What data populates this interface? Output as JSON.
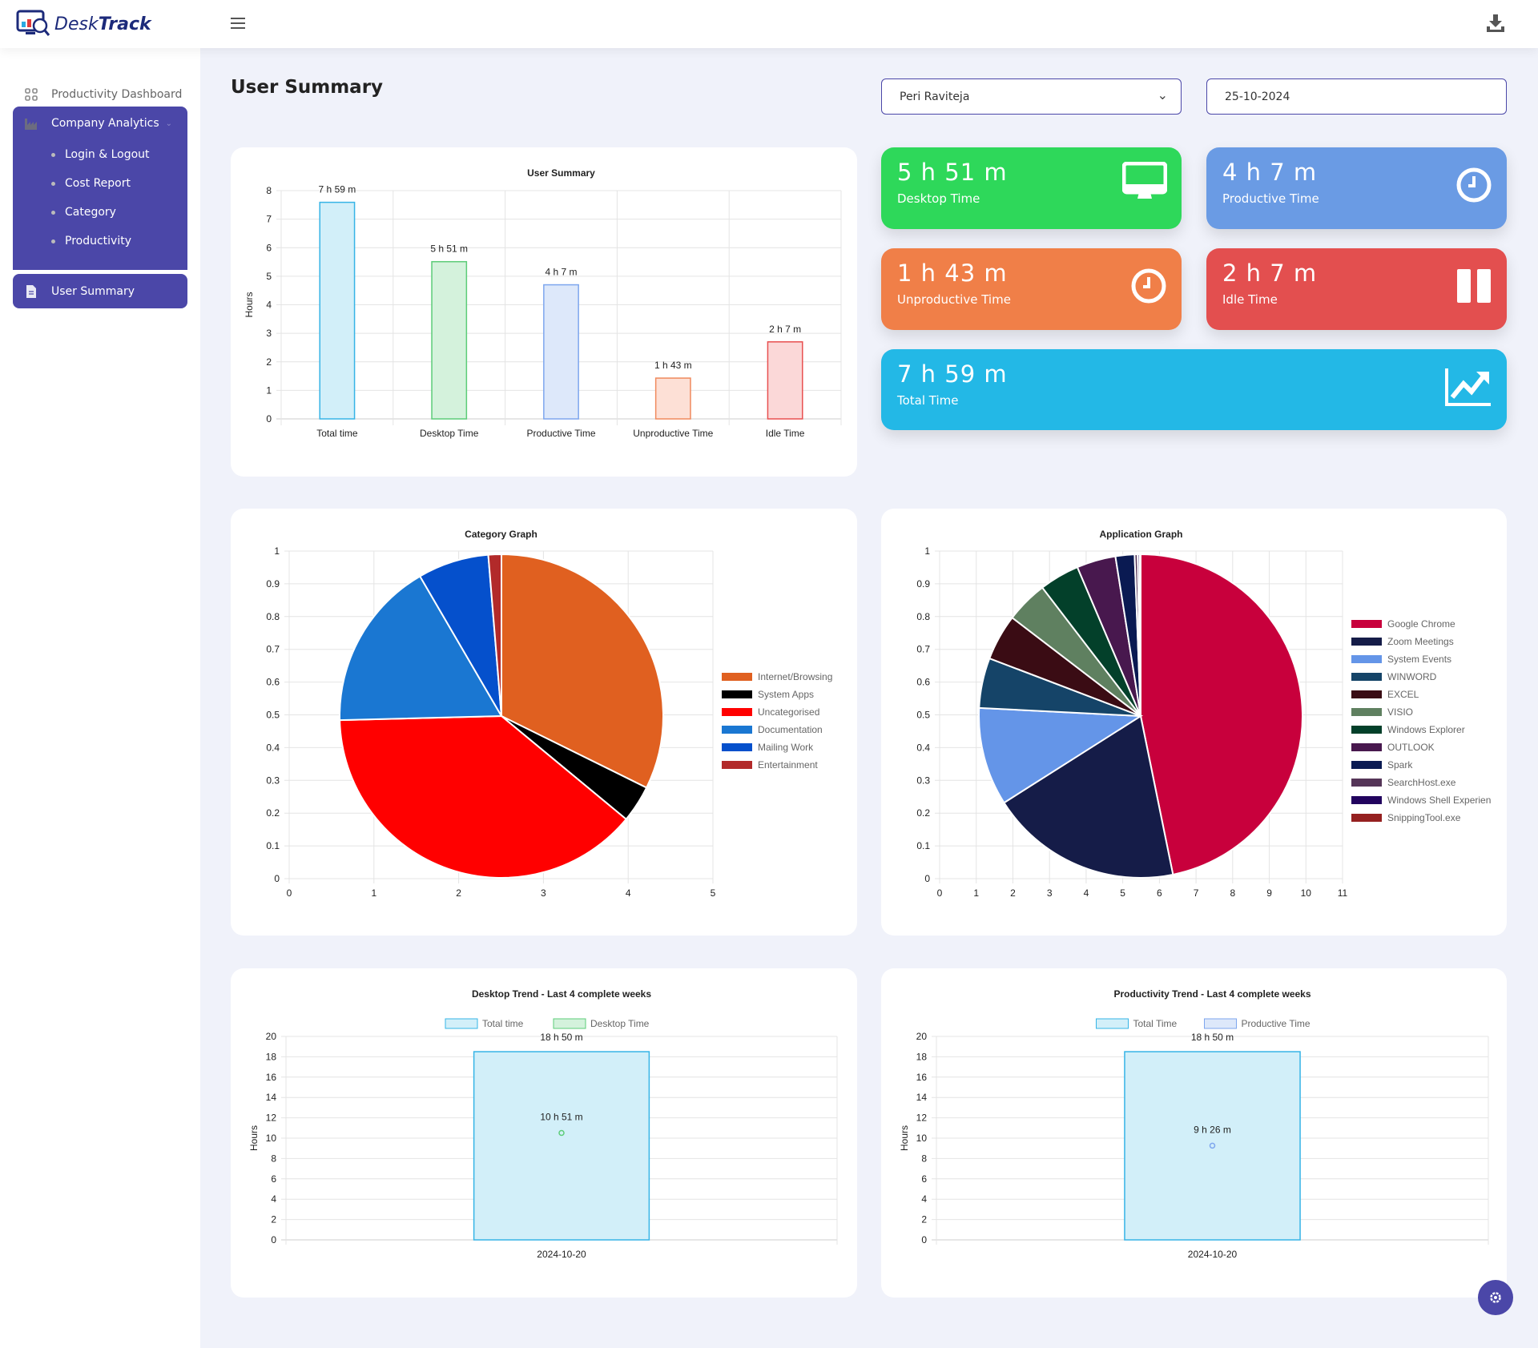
{
  "app": {
    "logo_text_light": "Desk",
    "logo_text_bold": "Track"
  },
  "sidebar": {
    "dashboard": "Productivity Dashboard",
    "group": "Company Analytics",
    "sub_items": [
      "Login & Logout",
      "Cost Report",
      "Category",
      "Productivity"
    ],
    "user_summary": "User Summary"
  },
  "page": {
    "title": "User Summary",
    "user_select": "Peri Raviteja",
    "date": "25-10-2024"
  },
  "stats": {
    "desktop": {
      "value": "5 h 51 m",
      "label": "Desktop Time",
      "color": "#2ed85a"
    },
    "productive": {
      "value": "4 h 7 m",
      "label": "Productive Time",
      "color": "#6a9be4"
    },
    "unproductive": {
      "value": "1 h 43 m",
      "label": "Unproductive Time",
      "color": "#f07f48"
    },
    "idle": {
      "value": "2 h 7 m",
      "label": "Idle Time",
      "color": "#e34f4f"
    },
    "total": {
      "value": "7 h 59 m",
      "label": "Total Time",
      "color": "#23b8e6"
    }
  },
  "chart_data": [
    {
      "type": "bar",
      "title": "User Summary",
      "ylabel": "Hours",
      "ylim": [
        0,
        8
      ],
      "yticks": [
        0,
        1,
        2,
        3,
        4,
        5,
        6,
        7,
        8
      ],
      "grid": true,
      "categories": [
        "Total time",
        "Desktop Time",
        "Productive Time",
        "Unproductive Time",
        "Idle Time"
      ],
      "values": [
        7.59,
        5.51,
        4.7,
        1.43,
        2.7
      ],
      "data_labels": [
        "7 h 59 m",
        "5 h 51 m",
        "4 h 7 m",
        "1 h 43 m",
        "2 h 7 m"
      ],
      "fills": [
        "#d2eff9",
        "#d4f2dc",
        "#dde8fa",
        "#fde0d6",
        "#fbd8d8"
      ],
      "strokes": [
        "#36b4e6",
        "#5ccc78",
        "#7ea6ee",
        "#f08a5d",
        "#e85050"
      ]
    },
    {
      "type": "pie",
      "title": "Category Graph",
      "grid": true,
      "xlim": [
        0,
        5
      ],
      "ylim": [
        0,
        1
      ],
      "legend": "right",
      "labels": [
        "Internet/Browsing",
        "System Apps",
        "Uncategorised",
        "Documentation",
        "Mailing Work",
        "Entertainment"
      ],
      "values": [
        0.323,
        0.037,
        0.386,
        0.17,
        0.071,
        0.013
      ],
      "colors": [
        "#e06020",
        "#000000",
        "#ff0000",
        "#1a77d2",
        "#0550cc",
        "#b22a2a"
      ]
    },
    {
      "type": "pie",
      "title": "Application Graph",
      "grid": true,
      "xlim": [
        0,
        11
      ],
      "ylim": [
        0,
        1
      ],
      "legend": "right",
      "labels": [
        "Google Chrome",
        "Zoom Meetings",
        "System Events",
        "WINWORD",
        "EXCEL",
        "VISIO",
        "Windows Explorer",
        "OUTLOOK",
        "Spark",
        "SearchHost.exe",
        "Windows Shell Experien",
        "SnippingTool.exe"
      ],
      "values": [
        0.468,
        0.192,
        0.098,
        0.05,
        0.046,
        0.042,
        0.04,
        0.039,
        0.019,
        0.003,
        0.002,
        0.001
      ],
      "colors": [
        "#c8003c",
        "#151c48",
        "#6495e8",
        "#154468",
        "#3a0c14",
        "#5f8060",
        "#03402a",
        "#48184e",
        "#0a1a52",
        "#553558",
        "#22035e",
        "#952020"
      ]
    },
    {
      "type": "bar",
      "title": "Desktop Trend - Last 4 complete weeks",
      "ylabel": "Hours",
      "ylim": [
        0,
        20
      ],
      "yticks": [
        0,
        2,
        4,
        6,
        8,
        10,
        12,
        14,
        16,
        18,
        20
      ],
      "grid": true,
      "legend": "top",
      "categories": [
        "2024-10-20"
      ],
      "series": [
        {
          "name": "Total time",
          "type": "bar",
          "values": [
            18.5
          ],
          "labels": [
            "18 h 50 m"
          ],
          "fill": "#d2eff9",
          "stroke": "#36b4e6"
        },
        {
          "name": "Desktop Time",
          "type": "point",
          "values": [
            10.51
          ],
          "labels": [
            "10 h 51 m"
          ],
          "fill": "#d4f2dc",
          "stroke": "#5ccc78"
        }
      ]
    },
    {
      "type": "bar",
      "title": "Productivity Trend - Last 4 complete weeks",
      "ylabel": "Hours",
      "ylim": [
        0,
        20
      ],
      "yticks": [
        0,
        2,
        4,
        6,
        8,
        10,
        12,
        14,
        16,
        18,
        20
      ],
      "grid": true,
      "legend": "top",
      "categories": [
        "2024-10-20"
      ],
      "series": [
        {
          "name": "Total Time",
          "type": "bar",
          "values": [
            18.5
          ],
          "labels": [
            "18 h 50 m"
          ],
          "fill": "#d2eff9",
          "stroke": "#36b4e6"
        },
        {
          "name": "Productive Time",
          "type": "point",
          "values": [
            9.26
          ],
          "labels": [
            "9 h 26 m"
          ],
          "fill": "#dde8fa",
          "stroke": "#7ea6ee"
        }
      ]
    }
  ]
}
